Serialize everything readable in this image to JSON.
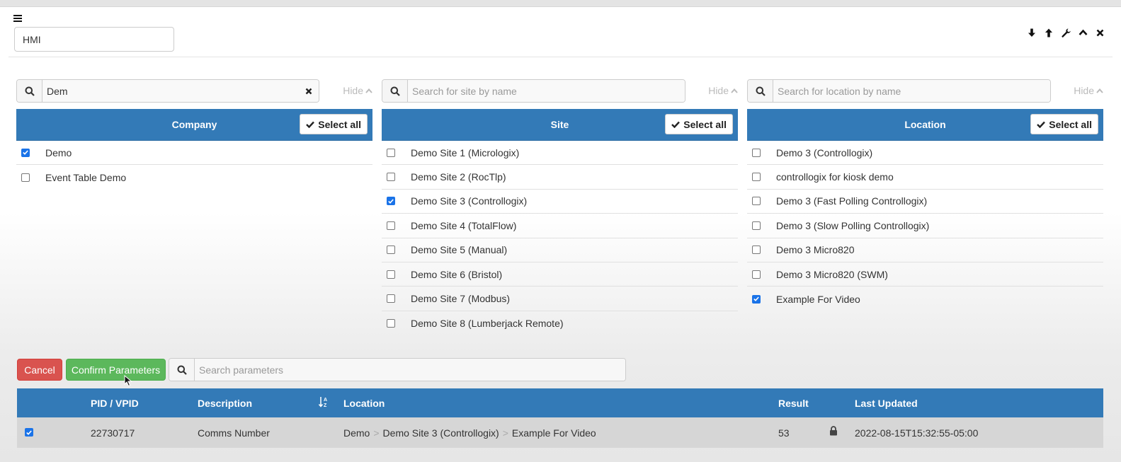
{
  "app": {
    "title_value": "HMI"
  },
  "icons": {
    "menu": "hamburger-icon",
    "window_controls": [
      "arrow-down-icon",
      "arrow-up-icon",
      "wrench-icon",
      "chevron-up-icon",
      "close-icon"
    ]
  },
  "colors": {
    "header_blue": "#337ab7",
    "cancel_red": "#d9534f",
    "confirm_green": "#5cb85c",
    "checkbox_blue": "#1a73e8"
  },
  "company": {
    "search_value": "Dem",
    "search_placeholder": "",
    "hide_label": "Hide",
    "header": "Company",
    "select_all_label": "Select all",
    "items": [
      {
        "label": "Demo",
        "checked": true
      },
      {
        "label": "Event Table Demo",
        "checked": false
      }
    ]
  },
  "site": {
    "search_value": "",
    "search_placeholder": "Search for site by name",
    "hide_label": "Hide",
    "header": "Site",
    "select_all_label": "Select all",
    "items": [
      {
        "label": "Demo Site 1 (Micrologix)",
        "checked": false
      },
      {
        "label": "Demo Site 2 (RocTlp)",
        "checked": false
      },
      {
        "label": "Demo Site 3 (Controllogix)",
        "checked": true
      },
      {
        "label": "Demo Site 4 (TotalFlow)",
        "checked": false
      },
      {
        "label": "Demo Site 5 (Manual)",
        "checked": false
      },
      {
        "label": "Demo Site 6 (Bristol)",
        "checked": false
      },
      {
        "label": "Demo Site 7 (Modbus)",
        "checked": false
      },
      {
        "label": "Demo Site 8 (Lumberjack Remote)",
        "checked": false
      }
    ]
  },
  "location": {
    "search_value": "",
    "search_placeholder": "Search for location by name",
    "hide_label": "Hide",
    "header": "Location",
    "select_all_label": "Select all",
    "items": [
      {
        "label": "Demo 3 (Controllogix)",
        "checked": false
      },
      {
        "label": "controllogix for kiosk demo",
        "checked": false
      },
      {
        "label": "Demo 3 (Fast Polling Controllogix)",
        "checked": false
      },
      {
        "label": "Demo 3 (Slow Polling Controllogix)",
        "checked": false
      },
      {
        "label": "Demo 3 Micro820",
        "checked": false
      },
      {
        "label": "Demo 3 Micro820 (SWM)",
        "checked": false
      },
      {
        "label": "Example For Video",
        "checked": true
      }
    ]
  },
  "actions": {
    "cancel_label": "Cancel",
    "confirm_label": "Confirm Parameters",
    "param_search_placeholder": "Search parameters"
  },
  "results": {
    "columns": [
      "PID / VPID",
      "Description",
      "Location",
      "Result",
      "Last Updated"
    ],
    "rows": [
      {
        "checked": true,
        "pid": "22730717",
        "description": "Comms Number",
        "location_path": [
          "Demo",
          "Demo Site 3 (Controllogix)",
          "Example For Video"
        ],
        "result": "53",
        "locked": true,
        "last_updated": "2022-08-15T15:32:55-05:00"
      }
    ]
  }
}
